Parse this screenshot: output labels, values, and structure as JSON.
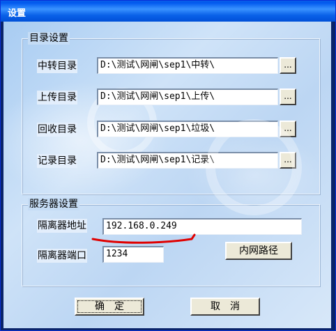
{
  "window": {
    "title": "设置"
  },
  "directory_group": {
    "title": "目录设置",
    "rows": [
      {
        "label": "中转目录",
        "value": "D:\\测试\\网闸\\sep1\\中转\\",
        "browse": "..."
      },
      {
        "label": "上传目录",
        "value": "D:\\测试\\网闸\\sep1\\上传\\",
        "browse": "..."
      },
      {
        "label": "回收目录",
        "value": "D:\\测试\\网闸\\sep1\\垃圾\\",
        "browse": "..."
      },
      {
        "label": "记录目录",
        "value": "D:\\测试\\网闸\\sep1\\记录\\",
        "browse": "..."
      }
    ]
  },
  "server_group": {
    "title": "服务器设置",
    "address_label": "隔离器地址",
    "address_value": "192.168.0.249",
    "port_label": "隔离器端口",
    "port_value": "1234",
    "route_button": "内网路径"
  },
  "buttons": {
    "ok": "确定",
    "cancel": "取消"
  },
  "colors": {
    "title_bar": "#0a5ee8",
    "annotation": "#e00000"
  }
}
